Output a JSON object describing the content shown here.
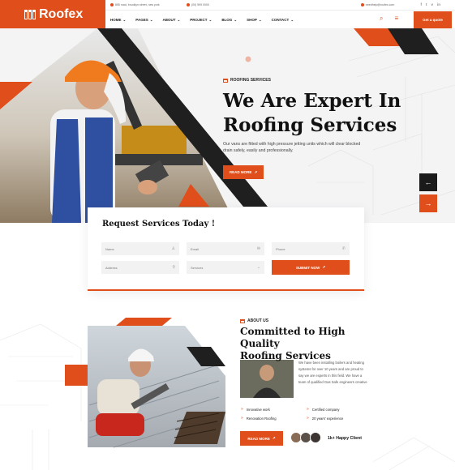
{
  "brand": {
    "name": "Roofex",
    "accent": "#e04e1b",
    "dark": "#1a1a1a"
  },
  "topbar": {
    "address": "855 road, brooklyn street, new york",
    "phone": "(00) 599 0000",
    "email": "needhelp@roofex.com",
    "social_icons": [
      "facebook-icon",
      "twitter-icon",
      "vimeo-icon",
      "linkedin-icon"
    ],
    "social_glyphs": [
      "f",
      "t",
      "v",
      "in"
    ]
  },
  "nav": {
    "items": [
      {
        "label": "HOME",
        "caret": "⌄"
      },
      {
        "label": "PAGES",
        "caret": "⌄"
      },
      {
        "label": "ABOUT",
        "caret": "⌄"
      },
      {
        "label": "PROJECT",
        "caret": "⌄"
      },
      {
        "label": "BLOG",
        "caret": "⌄"
      },
      {
        "label": "SHOP",
        "caret": "⌄"
      },
      {
        "label": "CONTACT",
        "caret": "⌄"
      }
    ]
  },
  "header": {
    "quote_label": "Get a quote",
    "search_glyph": "⌕",
    "menu_glyph": "≡"
  },
  "hero": {
    "eyebrow": "ROOFING SERVICES",
    "title_line1": "We Are Expert In",
    "title_line2": "Roofing Services",
    "text": "Our vans are fitted with high pressure jetting units which will clear blocked drain safely, easily and professionally.",
    "button_label": "READ MORE",
    "button_arrow": "↗",
    "prev_glyph": "←",
    "next_glyph": "→"
  },
  "request": {
    "title": "Request Services Today !",
    "fields": [
      {
        "placeholder": "Name",
        "icon": "user-icon",
        "glyph": "♙"
      },
      {
        "placeholder": "Email",
        "icon": "mail-icon",
        "glyph": "✉"
      },
      {
        "placeholder": "Phone",
        "icon": "phone-icon",
        "glyph": "✆"
      },
      {
        "placeholder": "Address",
        "icon": "pin-icon",
        "glyph": "⚲"
      },
      {
        "placeholder": "Services",
        "icon": "chevron-down-icon",
        "glyph": "⌄"
      }
    ],
    "submit_label": "SUBMIT NOW",
    "submit_arrow": "↗"
  },
  "about": {
    "eyebrow": "ABOUT US",
    "title_line1": "Committed to High Quality",
    "title_line2": "Roofing Services",
    "text": "We have been installing boilers and heating systems for over 10 years and are proud to say we are experts in this field. We have a team of qualified Gas Safe engineers creative",
    "features": [
      "Innovative work",
      "Certified company",
      "Renovation Roofing",
      "20 years' experience"
    ],
    "check_glyph": "»",
    "button_label": "READ MORE",
    "button_arrow": "↗",
    "clients_label": "1k+ Happy Client"
  }
}
